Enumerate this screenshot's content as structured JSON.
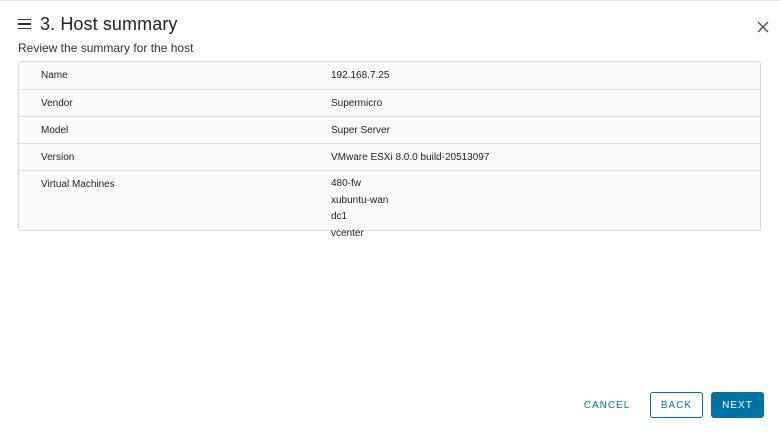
{
  "header": {
    "title": "3. Host summary",
    "subtitle": "Review the summary for the host"
  },
  "summary": {
    "rows": [
      {
        "label": "Name",
        "value": "192.168.7.25"
      },
      {
        "label": "Vendor",
        "value": "Supermicro"
      },
      {
        "label": "Model",
        "value": "Super Server"
      },
      {
        "label": "Version",
        "value": "VMware ESXi 8.0.0 build-20513097"
      },
      {
        "label": "Virtual Machines",
        "values": [
          "480-fw",
          "xubuntu-wan",
          "dc1",
          "vcenter"
        ]
      }
    ]
  },
  "footer": {
    "cancel_label": "CANCEL",
    "back_label": "BACK",
    "next_label": "NEXT"
  },
  "colors": {
    "accent": "#0072a3",
    "table_background": "#fafafa",
    "border": "#d7d7d7"
  },
  "icons": {
    "menu": "menu-icon",
    "close": "close-icon"
  }
}
